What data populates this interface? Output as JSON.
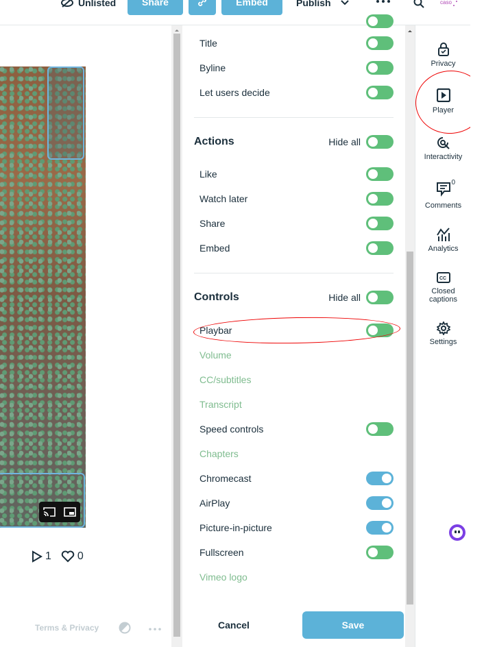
{
  "topbar": {
    "unlisted_label": "Unlisted",
    "share_label": "Share",
    "embed_label": "Embed",
    "publish_label": "Publish",
    "accent": "#5cb2d8"
  },
  "video": {
    "stats": {
      "plays": "1",
      "likes": "0"
    }
  },
  "footer": {
    "terms": "Terms & Privacy"
  },
  "panel": {
    "rows_top": [
      {
        "label": "Title",
        "state": "off"
      },
      {
        "label": "Byline",
        "state": "off"
      },
      {
        "label": "Let users decide",
        "state": "off"
      }
    ],
    "actions": {
      "heading": "Actions",
      "hide_all": "Hide all",
      "rows": [
        {
          "label": "Like",
          "state": "off"
        },
        {
          "label": "Watch later",
          "state": "off"
        },
        {
          "label": "Share",
          "state": "off"
        },
        {
          "label": "Embed",
          "state": "off"
        }
      ]
    },
    "controls": {
      "heading": "Controls",
      "hide_all": "Hide all",
      "rows": [
        {
          "label": "Playbar",
          "state": "off",
          "disabled": false
        },
        {
          "label": "Volume",
          "disabled": true
        },
        {
          "label": "CC/subtitles",
          "disabled": true
        },
        {
          "label": "Transcript",
          "disabled": true
        },
        {
          "label": "Speed controls",
          "state": "off",
          "disabled": false
        },
        {
          "label": "Chapters",
          "disabled": true
        },
        {
          "label": "Chromecast",
          "state": "on",
          "disabled": false
        },
        {
          "label": "AirPlay",
          "state": "on",
          "disabled": false
        },
        {
          "label": "Picture-in-picture",
          "state": "on",
          "disabled": false
        },
        {
          "label": "Fullscreen",
          "state": "off",
          "disabled": false
        },
        {
          "label": "Vimeo logo",
          "disabled": true
        }
      ]
    },
    "cancel_label": "Cancel",
    "save_label": "Save"
  },
  "rail": {
    "items": [
      {
        "label": "Privacy",
        "icon": "lock-icon"
      },
      {
        "label": "Player",
        "icon": "player-icon"
      },
      {
        "label": "Interactivity",
        "icon": "interactivity-icon"
      },
      {
        "label": "Comments",
        "icon": "comments-icon",
        "badge": "0"
      },
      {
        "label": "Analytics",
        "icon": "analytics-icon"
      },
      {
        "label": "Closed captions",
        "icon": "cc-icon"
      },
      {
        "label": "Settings",
        "icon": "gear-icon"
      }
    ]
  }
}
